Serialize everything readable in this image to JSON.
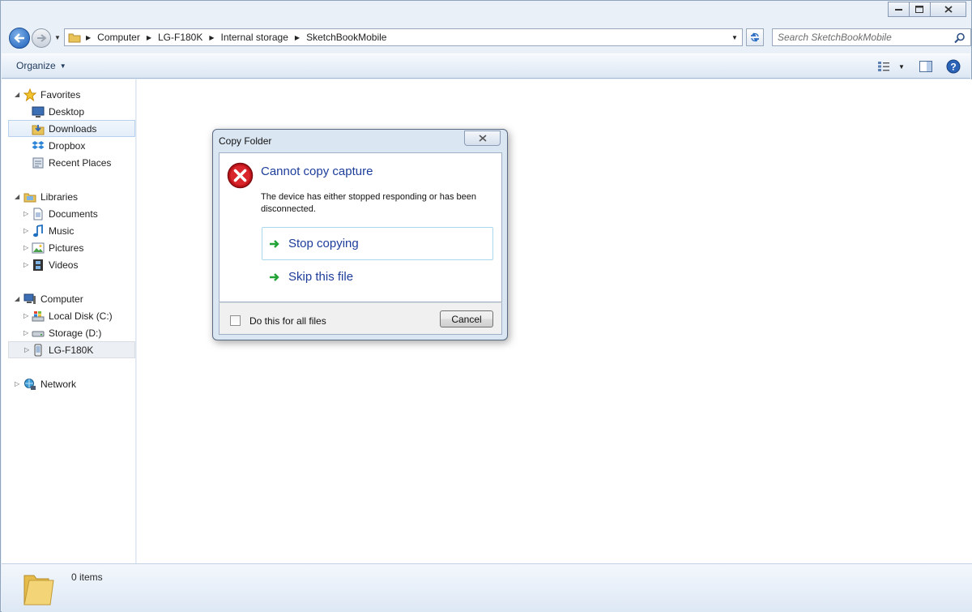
{
  "window": {
    "controls": [
      "minimize",
      "maximize",
      "close"
    ]
  },
  "address": {
    "crumbs": [
      "Computer",
      "LG-F180K",
      "Internal storage",
      "SketchBookMobile"
    ]
  },
  "search": {
    "placeholder": "Search SketchBookMobile"
  },
  "toolbar": {
    "organize_label": "Organize"
  },
  "sidebar": {
    "favorites": {
      "label": "Favorites",
      "items": [
        "Desktop",
        "Downloads",
        "Dropbox",
        "Recent Places"
      ]
    },
    "libraries": {
      "label": "Libraries",
      "items": [
        "Documents",
        "Music",
        "Pictures",
        "Videos"
      ]
    },
    "computer": {
      "label": "Computer",
      "items": [
        "Local Disk (C:)",
        "Storage (D:)",
        "LG-F180K"
      ]
    },
    "network": {
      "label": "Network"
    }
  },
  "status": {
    "count": "0 items"
  },
  "dialog": {
    "title": "Copy Folder",
    "heading": "Cannot copy capture",
    "message": "The device has either stopped responding or has been disconnected.",
    "commands": [
      "Stop copying",
      "Skip this file"
    ],
    "checkbox_label": "Do this for all files",
    "cancel_label": "Cancel"
  },
  "colors": {
    "accent": "#1d3d9a",
    "error": "#c0151b",
    "go_arrow": "#21a336"
  }
}
